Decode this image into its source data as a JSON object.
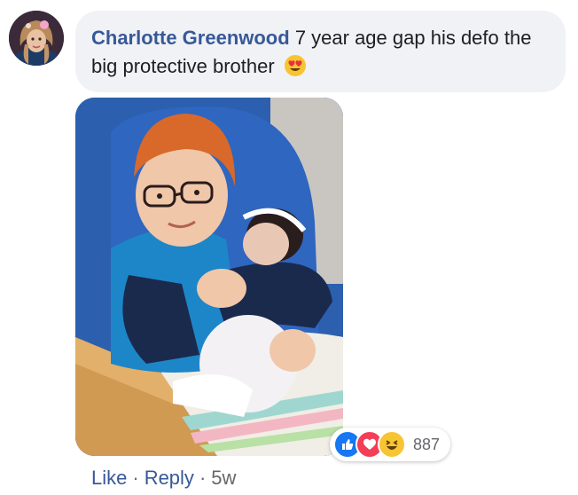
{
  "comment": {
    "author": "Charlotte Greenwood",
    "text": "7 year age gap his defo the big protective brother",
    "emoji": "heart-eyes-emoji",
    "photo": "photo-of-boy-holding-newborn"
  },
  "reactions": {
    "icons": [
      "like-icon",
      "love-icon",
      "haha-icon"
    ],
    "count": "887"
  },
  "actions": {
    "like": "Like",
    "reply": "Reply",
    "separator": "·",
    "time": "5w"
  },
  "colors": {
    "link": "#385898",
    "bubble": "#f0f2f5",
    "meta": "#65676b"
  }
}
